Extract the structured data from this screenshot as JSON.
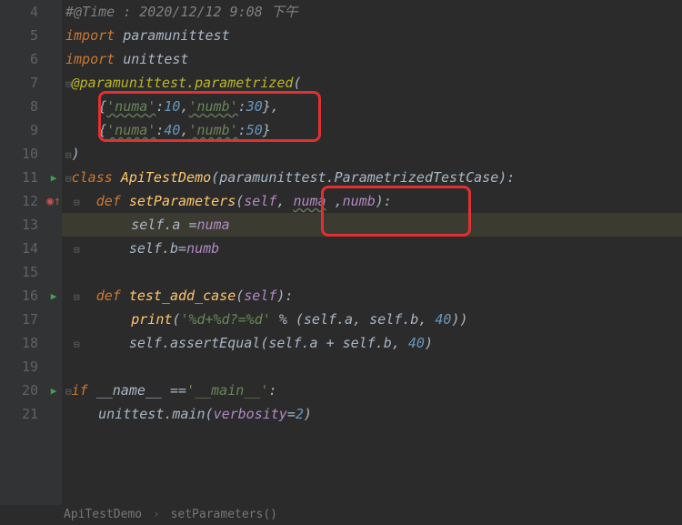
{
  "gutter": [
    "4",
    "5",
    "6",
    "7",
    "8",
    "9",
    "10",
    "11",
    "12",
    "13",
    "14",
    "15",
    "16",
    "17",
    "18",
    "19",
    "20",
    "21"
  ],
  "code": {
    "l4": {
      "comment": "#@Time : 2020/12/12 9:08 下午"
    },
    "l5": {
      "kw": "import",
      "mod": "paramunittest"
    },
    "l6": {
      "kw": "import",
      "mod": "unittest"
    },
    "l7": {
      "dec": "@paramunittest.parametrized",
      "open": "("
    },
    "l8": {
      "k1": "'numa'",
      "v1": "10",
      "k2": "'numb'",
      "v2": "30"
    },
    "l9": {
      "k1": "'numa'",
      "v1": "40",
      "k2": "'numb'",
      "v2": "50"
    },
    "l10": {
      "close": ")"
    },
    "l11": {
      "kw": "class",
      "name": "ApiTestDemo",
      "base": "paramunittest.ParametrizedTestCase"
    },
    "l12": {
      "kw": "def",
      "name": "setParameters",
      "p0": "self",
      "p1": "numa",
      "p2": "numb"
    },
    "l13": {
      "lhs": "self.a =",
      "rhs": "numa"
    },
    "l14": {
      "lhs": "self.b=",
      "rhs": "numb"
    },
    "l16": {
      "kw": "def",
      "name": "test_add_case",
      "p0": "self"
    },
    "l17": {
      "fn": "print",
      "fmt": "'%d+%d?=%d'",
      "op": "%",
      "a": "self.a",
      "b": "self.b",
      "c": "40"
    },
    "l18": {
      "call": "self.assertEqual",
      "a": "self.a",
      "op": "+",
      "b": "self.b",
      "c": "40"
    },
    "l20": {
      "kw": "if",
      "name": "__name__",
      "cmp": "==",
      "val": "'__main__'"
    },
    "l21": {
      "call": "unittest.main",
      "kw": "verbosity",
      "op": "=",
      "val": "2"
    }
  },
  "breadcrumb": {
    "a": "ApiTestDemo",
    "b": "setParameters()"
  }
}
